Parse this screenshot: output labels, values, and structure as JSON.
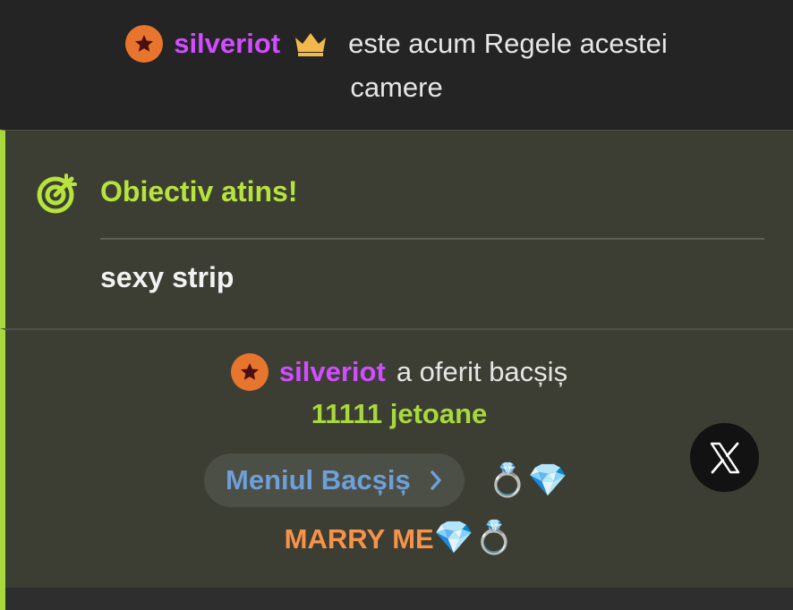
{
  "king_banner": {
    "username": "silveriot",
    "message_line1": "este acum Regele acestei",
    "message_line2": "camere"
  },
  "goal": {
    "title": "Obiectiv atins!",
    "description": "sexy strip"
  },
  "tip": {
    "username": "silveriot",
    "action": "a oferit bacșiș",
    "amount": "11111 jetoane",
    "menu_label": "Meniul Bacșiș",
    "menu_emoji": "💍💎",
    "item_text": "MARRY ME",
    "item_emoji": "💎💍"
  },
  "colors": {
    "accent_green": "#a8d83c",
    "username_purple": "#d14dff",
    "badge_orange": "#e8752e",
    "menu_blue": "#6f9fd8",
    "item_orange": "#f6934b"
  },
  "icons": [
    "star-badge-icon",
    "crown-icon",
    "goal-target-icon",
    "chevron-right-icon",
    "x-logo-icon"
  ]
}
